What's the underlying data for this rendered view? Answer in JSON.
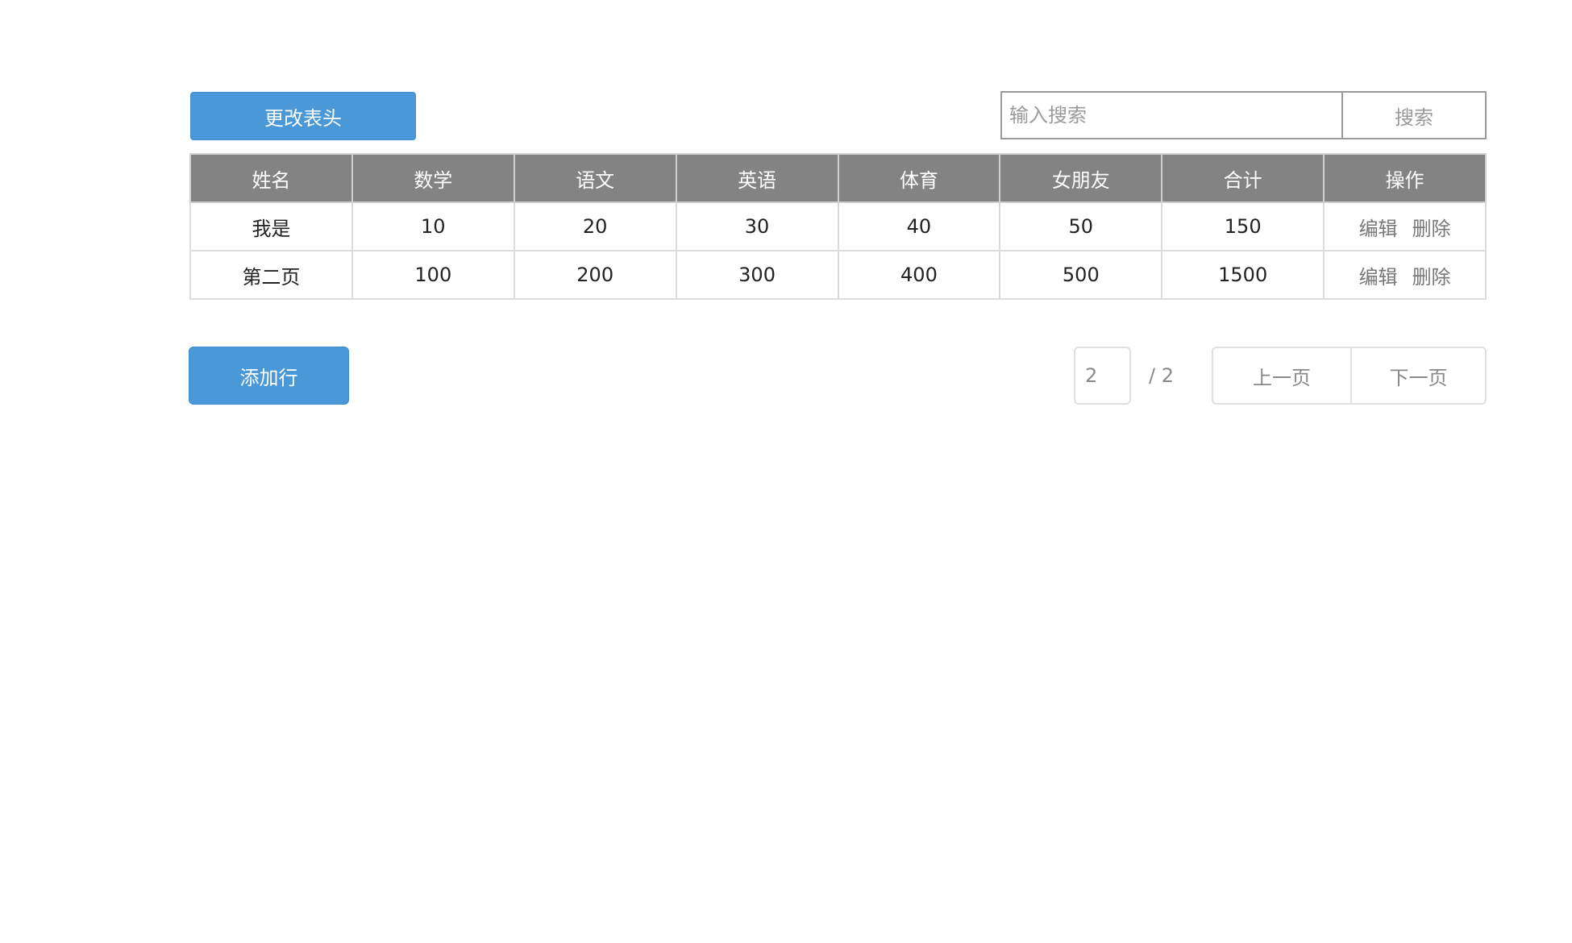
{
  "toolbar": {
    "change_header_label": "更改表头",
    "search_placeholder": "输入搜索",
    "search_value": "",
    "search_button_label": "搜索"
  },
  "table": {
    "headers": [
      "姓名",
      "数学",
      "语文",
      "英语",
      "体育",
      "女朋友",
      "合计",
      "操作"
    ],
    "rows": [
      {
        "cells": [
          "我是",
          "10",
          "20",
          "30",
          "40",
          "50",
          "150"
        ],
        "edit": "编辑",
        "delete": "删除"
      },
      {
        "cells": [
          "第二页",
          "100",
          "200",
          "300",
          "400",
          "500",
          "1500"
        ],
        "edit": "编辑",
        "delete": "删除"
      }
    ]
  },
  "footer": {
    "add_row_label": "添加行",
    "current_page": "2",
    "total_pages_text": "/ 2",
    "prev_label": "上一页",
    "next_label": "下一页"
  },
  "colors": {
    "primary": "#4a98d8",
    "header_bg": "#838383"
  }
}
